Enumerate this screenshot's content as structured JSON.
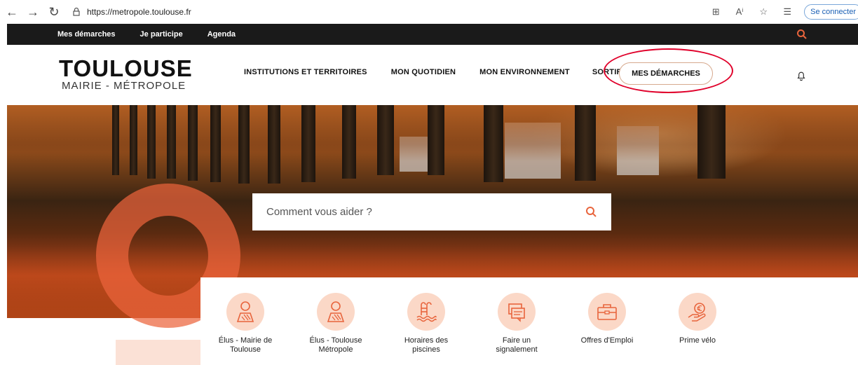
{
  "browser": {
    "url": "https://metropole.toulouse.fr",
    "connect_label": "Se connecter"
  },
  "topbar": {
    "links": [
      "Mes démarches",
      "Je participe",
      "Agenda"
    ]
  },
  "header": {
    "logo_main": "TOULOUSE",
    "logo_sub": "MAIRIE - MÉTROPOLE",
    "nav": [
      "INSTITUTIONS ET TERRITOIRES",
      "MON QUOTIDIEN",
      "MON ENVIRONNEMENT",
      "SORTIR"
    ],
    "cta": "MES DÉMARCHES"
  },
  "search": {
    "placeholder": "Comment vous aider ?"
  },
  "quick_links": [
    {
      "label": "Élus - Mairie de Toulouse",
      "icon": "person-icon"
    },
    {
      "label": "Élus - Toulouse Métropole",
      "icon": "person-icon"
    },
    {
      "label": "Horaires des piscines",
      "icon": "pool-icon"
    },
    {
      "label": "Faire un signalement",
      "icon": "report-icon"
    },
    {
      "label": "Offres d'Emploi",
      "icon": "briefcase-icon"
    },
    {
      "label": "Prime vélo",
      "icon": "euro-hand-icon"
    }
  ],
  "colors": {
    "accent": "#e8643c",
    "accent_light": "#fbd8c7",
    "topbar": "#1a1a1a",
    "annotation": "#e0002a"
  }
}
